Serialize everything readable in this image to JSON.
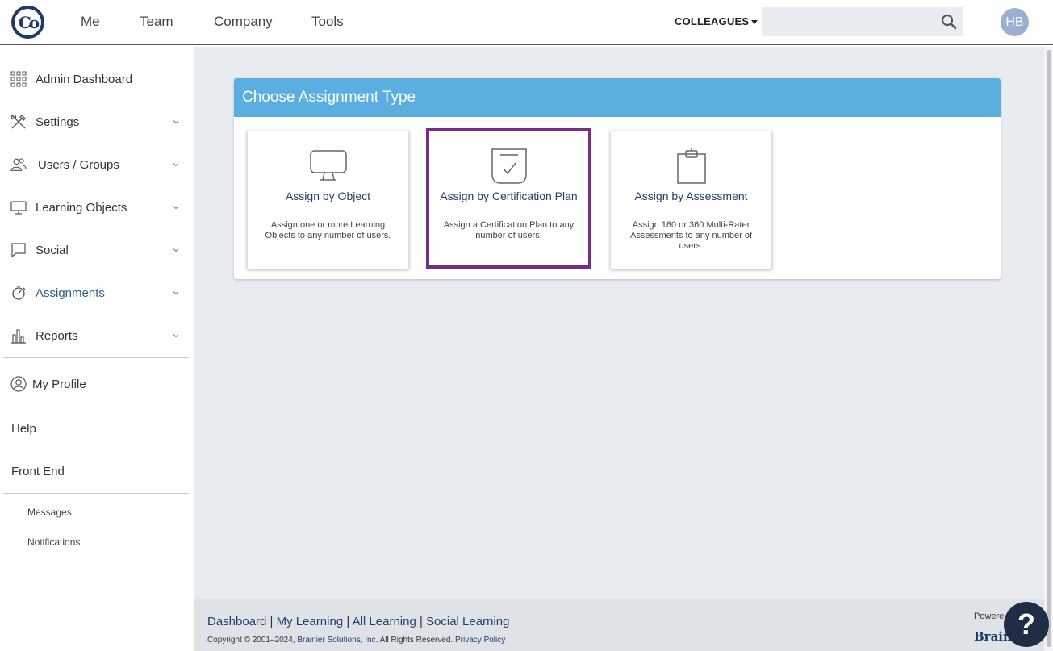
{
  "topnav": {
    "items": [
      "Me",
      "Team",
      "Company",
      "Tools"
    ],
    "colleagues_label": "COLLEAGUES",
    "search_placeholder": "",
    "avatar_initials": "HB"
  },
  "sidebar": {
    "items": [
      {
        "label": "Admin Dashboard",
        "icon": "grid-icon",
        "has_chevron": false
      },
      {
        "label": "Settings",
        "icon": "tools-icon",
        "has_chevron": true
      },
      {
        "label": "Users / Groups",
        "icon": "users-icon",
        "has_chevron": true
      },
      {
        "label": "Learning Objects",
        "icon": "monitor-icon",
        "has_chevron": true
      },
      {
        "label": "Social",
        "icon": "chat-icon",
        "has_chevron": true
      },
      {
        "label": "Assignments",
        "icon": "stopwatch-icon",
        "has_chevron": true,
        "active": true
      },
      {
        "label": "Reports",
        "icon": "bar-chart-icon",
        "has_chevron": true
      }
    ],
    "secondary": [
      {
        "label": "My Profile",
        "icon": "user-circle-icon"
      },
      {
        "label": "Help"
      },
      {
        "label": "Front End"
      }
    ],
    "small": [
      "Messages",
      "Notifications"
    ]
  },
  "panel": {
    "title": "Choose Assignment Type",
    "cards": [
      {
        "title": "Assign by Object",
        "desc": "Assign one or more Learning Objects to any number of users.",
        "icon": "monitor-icon",
        "selected": false
      },
      {
        "title": "Assign by Certification Plan",
        "desc": "Assign a Certification Plan to any number of users.",
        "icon": "certificate-icon",
        "selected": true
      },
      {
        "title": "Assign by Assessment",
        "desc": "Assign 180 or 360 Multi-Rater Assessments to any number of users.",
        "icon": "clipboard-icon",
        "selected": false
      }
    ]
  },
  "footer": {
    "links": [
      "Dashboard",
      "My Learning",
      "All Learning",
      "Social Learning"
    ],
    "copyright": "Copyright © 2001–2024,",
    "company": "Brainier Solutions, Inc.",
    "rights": "All Rights Reserved.",
    "privacy": "Privacy Policy",
    "powered": "Powere",
    "brand": "Brain"
  },
  "help_label": "?",
  "colors": {
    "panel_header": "#5aaee0",
    "selected_border": "#7a2a88",
    "link": "#1f3f6e",
    "active_nav": "#2e5b8a"
  }
}
